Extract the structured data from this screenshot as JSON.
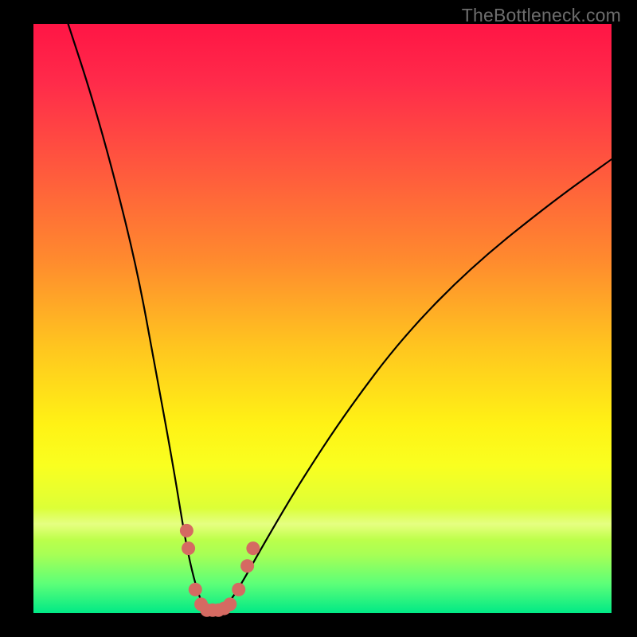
{
  "watermark": "TheBottleneck.com",
  "chart_data": {
    "type": "line",
    "title": "",
    "xlabel": "",
    "ylabel": "",
    "ylim": [
      0,
      100
    ],
    "xlim": [
      0,
      100
    ],
    "series": [
      {
        "name": "bottleneck-curve",
        "x": [
          6,
          10,
          14,
          18,
          21,
          24,
          26,
          27,
          28,
          29,
          30,
          32,
          34,
          36,
          40,
          46,
          54,
          64,
          76,
          90,
          100
        ],
        "values": [
          100,
          88,
          74,
          58,
          42,
          26,
          14,
          9,
          5,
          2,
          0,
          0,
          2,
          5,
          12,
          22,
          34,
          47,
          59,
          70,
          77
        ]
      }
    ],
    "dots": {
      "name": "sample-points",
      "color": "#d56a62",
      "points": [
        {
          "x": 26.5,
          "y": 14
        },
        {
          "x": 26.8,
          "y": 11
        },
        {
          "x": 28.0,
          "y": 4
        },
        {
          "x": 29.0,
          "y": 1.5
        },
        {
          "x": 30.0,
          "y": 0.5
        },
        {
          "x": 31.0,
          "y": 0.5
        },
        {
          "x": 32.0,
          "y": 0.5
        },
        {
          "x": 33.0,
          "y": 0.8
        },
        {
          "x": 34.0,
          "y": 1.5
        },
        {
          "x": 35.5,
          "y": 4
        },
        {
          "x": 37.0,
          "y": 8
        },
        {
          "x": 38.0,
          "y": 11
        }
      ]
    },
    "gradient_stops": [
      {
        "pos": 0,
        "color": "#ff1545"
      },
      {
        "pos": 25,
        "color": "#ff5a3d"
      },
      {
        "pos": 55,
        "color": "#ffc61f"
      },
      {
        "pos": 75,
        "color": "#f9ff20"
      },
      {
        "pos": 100,
        "color": "#00e986"
      }
    ]
  }
}
